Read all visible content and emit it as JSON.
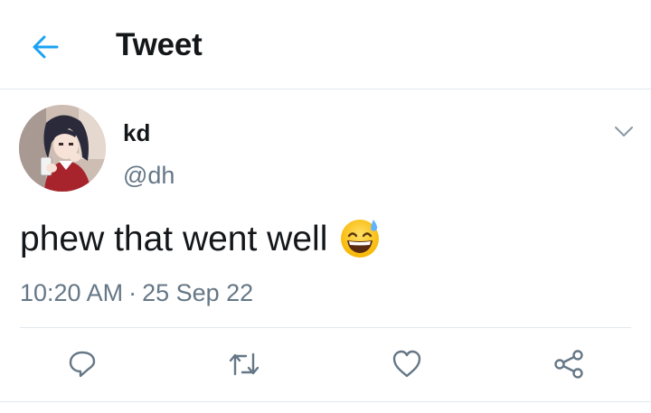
{
  "header": {
    "title": "Tweet",
    "back_icon": "arrow-left-icon"
  },
  "tweet": {
    "author_name": "kd",
    "author_handle": "@dh",
    "text": "phew that went well",
    "emoji": "grinning-face-with-sweat",
    "time": "10:20 AM",
    "separator": "·",
    "date": "25 Sep 22"
  },
  "actions": [
    {
      "name": "reply",
      "icon": "reply-icon"
    },
    {
      "name": "retweet",
      "icon": "retweet-icon"
    },
    {
      "name": "like",
      "icon": "heart-icon"
    },
    {
      "name": "share",
      "icon": "share-icon"
    }
  ],
  "colors": {
    "accent": "#1da1f2",
    "text": "#14171a",
    "secondary": "#657786",
    "divider": "#e1e8ed"
  }
}
